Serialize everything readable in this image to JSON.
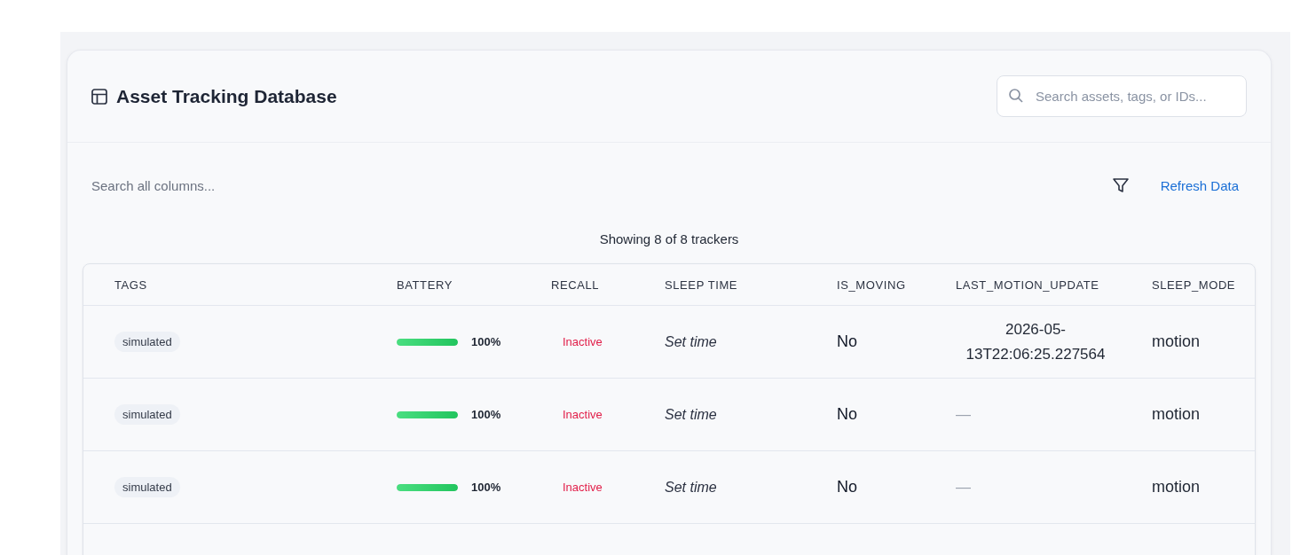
{
  "header": {
    "title": "Asset Tracking Database",
    "search": {
      "placeholder": "Search assets, tags, or IDs..."
    }
  },
  "toolbar": {
    "filter_placeholder": "Search all columns...",
    "refresh": "Refresh Data"
  },
  "summary": "Showing 8 of 8 trackers",
  "table": {
    "columns": [
      "TAGS",
      "BATTERY",
      "RECALL",
      "SLEEP TIME",
      "IS_MOVING",
      "LAST_MOTION_UPDATE",
      "SLEEP_MODE"
    ],
    "rows": [
      {
        "tag": "simulated",
        "battery": {
          "level": 1,
          "reading": "100%"
        },
        "recall": "Inactive",
        "sleep_time": "Set time",
        "is_moving": "No",
        "last_motion_update": "2026-05-13T22:06:25.227564",
        "sleep_mode": "motion"
      },
      {
        "tag": "simulated",
        "battery": {
          "level": 1,
          "reading": "100%"
        },
        "recall": "Inactive",
        "sleep_time": "Set time",
        "is_moving": "No",
        "last_motion_update": "—",
        "sleep_mode": "motion"
      },
      {
        "tag": "simulated",
        "battery": {
          "level": 1,
          "reading": "100%"
        },
        "recall": "Inactive",
        "sleep_time": "Set time",
        "is_moving": "No",
        "last_motion_update": "—",
        "sleep_mode": "motion"
      }
    ]
  }
}
